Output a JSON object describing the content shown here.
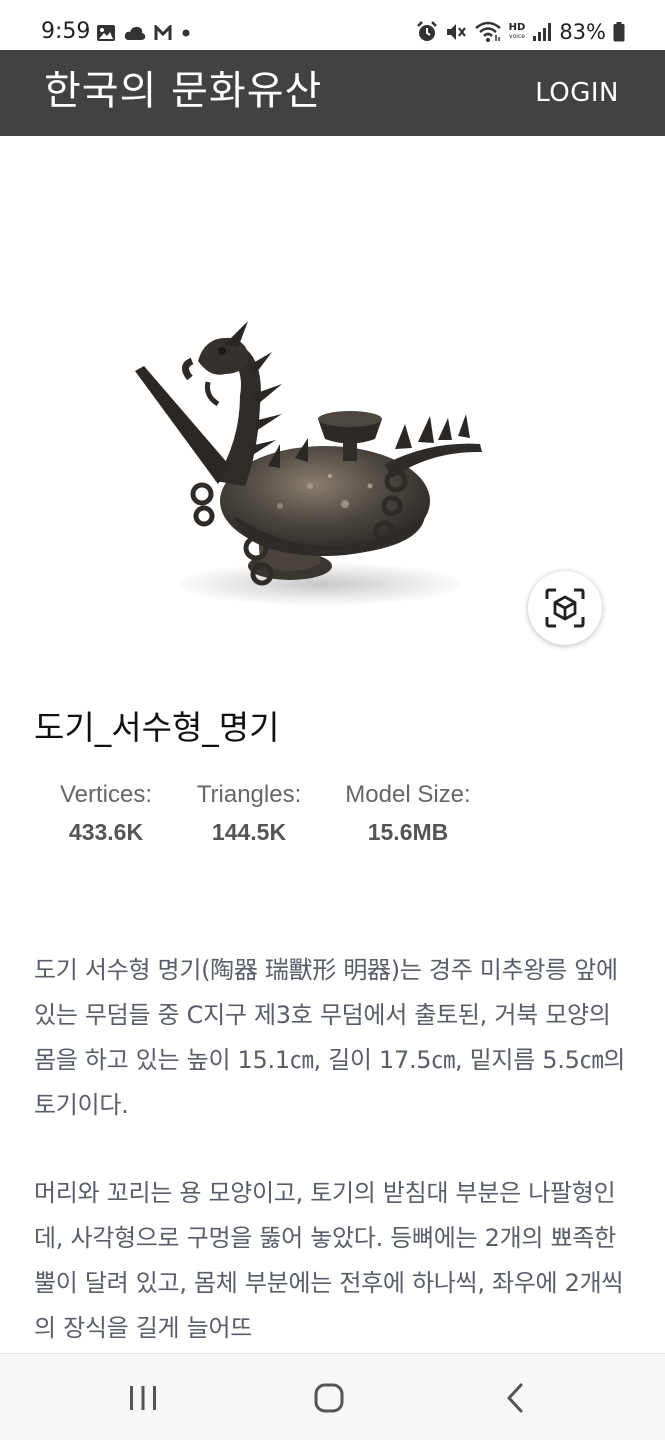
{
  "status_bar": {
    "time": "9:59",
    "battery": "83%",
    "left_icons": [
      "image-icon",
      "cloud-icon",
      "gmail-icon",
      "dot-icon"
    ],
    "right_icons": [
      "alarm-icon",
      "mute-icon",
      "wifi-icon",
      "hd-voice-icon",
      "signal-icon",
      "battery-icon"
    ],
    "hd_label": "HD",
    "voice_label": "voice"
  },
  "app_bar": {
    "title": "한국의 문화유산",
    "login_label": "LOGIN",
    "background": "#424242"
  },
  "viewer": {
    "ar_icon": "ar-cube-icon"
  },
  "model": {
    "title": "도기_서수형_명기",
    "stats": [
      {
        "label": "Vertices:",
        "value": "433.6K"
      },
      {
        "label": "Triangles:",
        "value": "144.5K"
      },
      {
        "label": "Model Size:",
        "value": "15.6MB"
      }
    ]
  },
  "description": {
    "paragraphs": [
      "도기 서수형 명기(陶器 瑞獸形 明器)는 경주 미추왕릉 앞에 있는 무덤들 중 C지구 제3호 무덤에서 출토된, 거북 모양의 몸을 하고 있는 높이 15.1㎝, 길이 17.5㎝, 밑지름 5.5㎝의 토기이다.",
      "머리와 꼬리는 용 모양이고, 토기의 받침대 부분은 나팔형인데, 사각형으로 구멍을 뚫어 놓았다. 등뼈에는 2개의 뾰족한 뿔이 달려 있고, 몸체 부분에는 전후에 하나씩, 좌우에 2개씩의 장식을 길게 늘어뜨"
    ]
  },
  "nav_bar": {
    "buttons": [
      "recent-apps-icon",
      "home-icon",
      "back-icon"
    ]
  }
}
